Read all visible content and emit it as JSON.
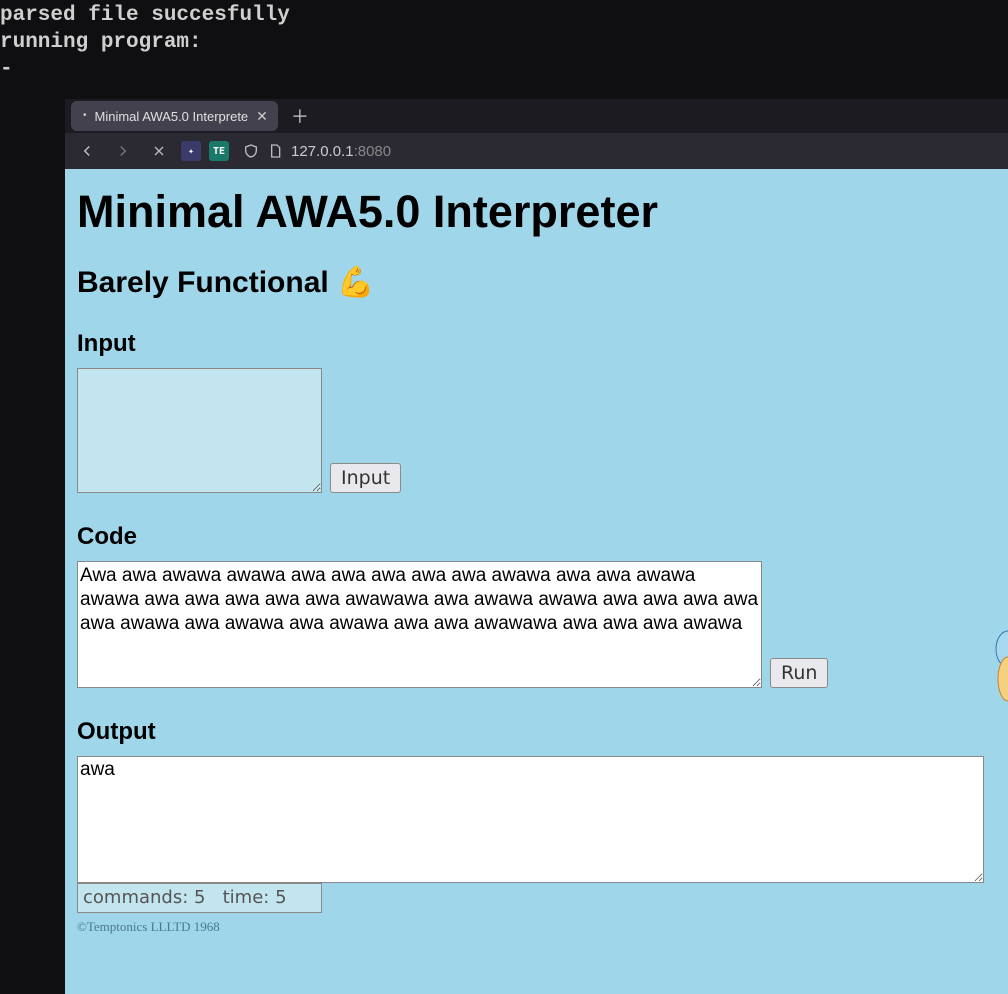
{
  "terminal": {
    "line1": "parsed file succesfully",
    "line2": "running program:",
    "line3": "-"
  },
  "browser": {
    "tab": {
      "title": "Minimal AWA5.0 Interprete"
    },
    "url": {
      "host": "127.0.0.1",
      "port": ":8080"
    },
    "ext1": "✦",
    "ext2": "TE"
  },
  "page": {
    "heading": "Minimal AWA5.0 Interpreter",
    "subheading": "Barely Functional 💪",
    "input_label": "Input",
    "input_btn": "Input",
    "input_value": "",
    "code_label": "Code",
    "code_value": "Awa awa awawa awawa awa awa awa awa awa awawa awa awa awawa awawa awa awa awa awa awa awawawa awa awawa awawa awa awa awa awa awa awawa awa awawa awa awawa awa awa awawawa awa awa awa awawa",
    "run_btn": "Run",
    "output_label": "Output",
    "output_value": "awa",
    "stats": "commands: 5   time: 5",
    "copyright": "©Temptonics LLLTD 1968"
  }
}
